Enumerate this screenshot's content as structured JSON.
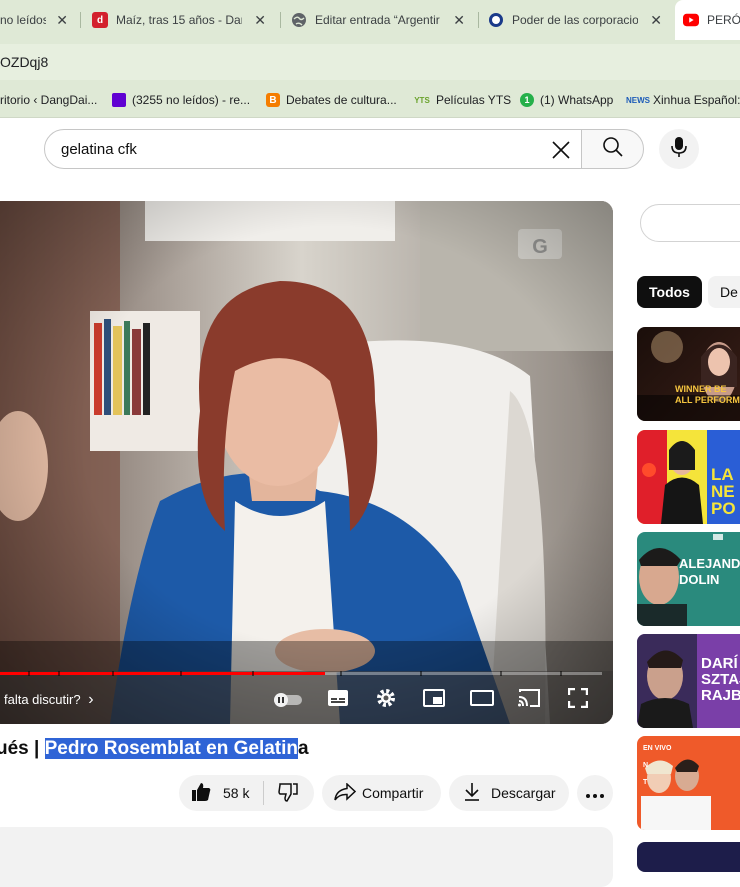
{
  "tabs": [
    {
      "title": "no leídos",
      "favicon": "mail-icon"
    },
    {
      "title": "Maíz, tras 15 años - Dar",
      "favicon": "news-icon"
    },
    {
      "title": "Editar entrada “Argentir",
      "favicon": "globe-icon"
    },
    {
      "title": "Poder de las corporacio",
      "favicon": "circle-icon"
    },
    {
      "title": "PERÓN",
      "favicon": "youtube-icon"
    }
  ],
  "tab_close_glyph": "✕",
  "address": {
    "url": "OZDqj8"
  },
  "bookmarks": [
    {
      "label": "ritorio ‹ DangDai..."
    },
    {
      "label": "(3255 no leídos) - re..."
    },
    {
      "label": "Debates de cultura..."
    },
    {
      "label": "Películas YTS"
    },
    {
      "label": "(1) WhatsApp"
    },
    {
      "label": "Xinhua Español:"
    }
  ],
  "search": {
    "query": "gelatina cfk"
  },
  "player": {
    "chapter_text": "falta discutir?",
    "chapter_chevron": "›",
    "progress_fraction": 0.54,
    "watermark": "G"
  },
  "video": {
    "title_prefix": "ués | ",
    "title_selected": "Pedro Rosemblat en Gelatin",
    "title_suffix": "a"
  },
  "actions": {
    "likes": "58 k",
    "share": "Compartir",
    "download": "Descargar"
  },
  "filters": {
    "all": "Todos",
    "next": "De"
  },
  "recommendations": [
    {
      "overlay_text": "WINNER BE\nALL PERFORM",
      "theme": "concert"
    },
    {
      "overlay_text": "LA\nNE\nPO",
      "theme": "yellow"
    },
    {
      "overlay_text": "ALEJAND\nDOLIN",
      "theme": "teal"
    },
    {
      "overlay_text": "DARÍ\nSZTAJN\nRAJB",
      "theme": "purple"
    },
    {
      "overlay_text": "EN VIVO\nN\nT",
      "theme": "orange"
    }
  ],
  "colors": {
    "chrome_bg": "#dfe9d6",
    "youtube_red": "#ff0000",
    "selection_blue": "#2f64d6"
  }
}
